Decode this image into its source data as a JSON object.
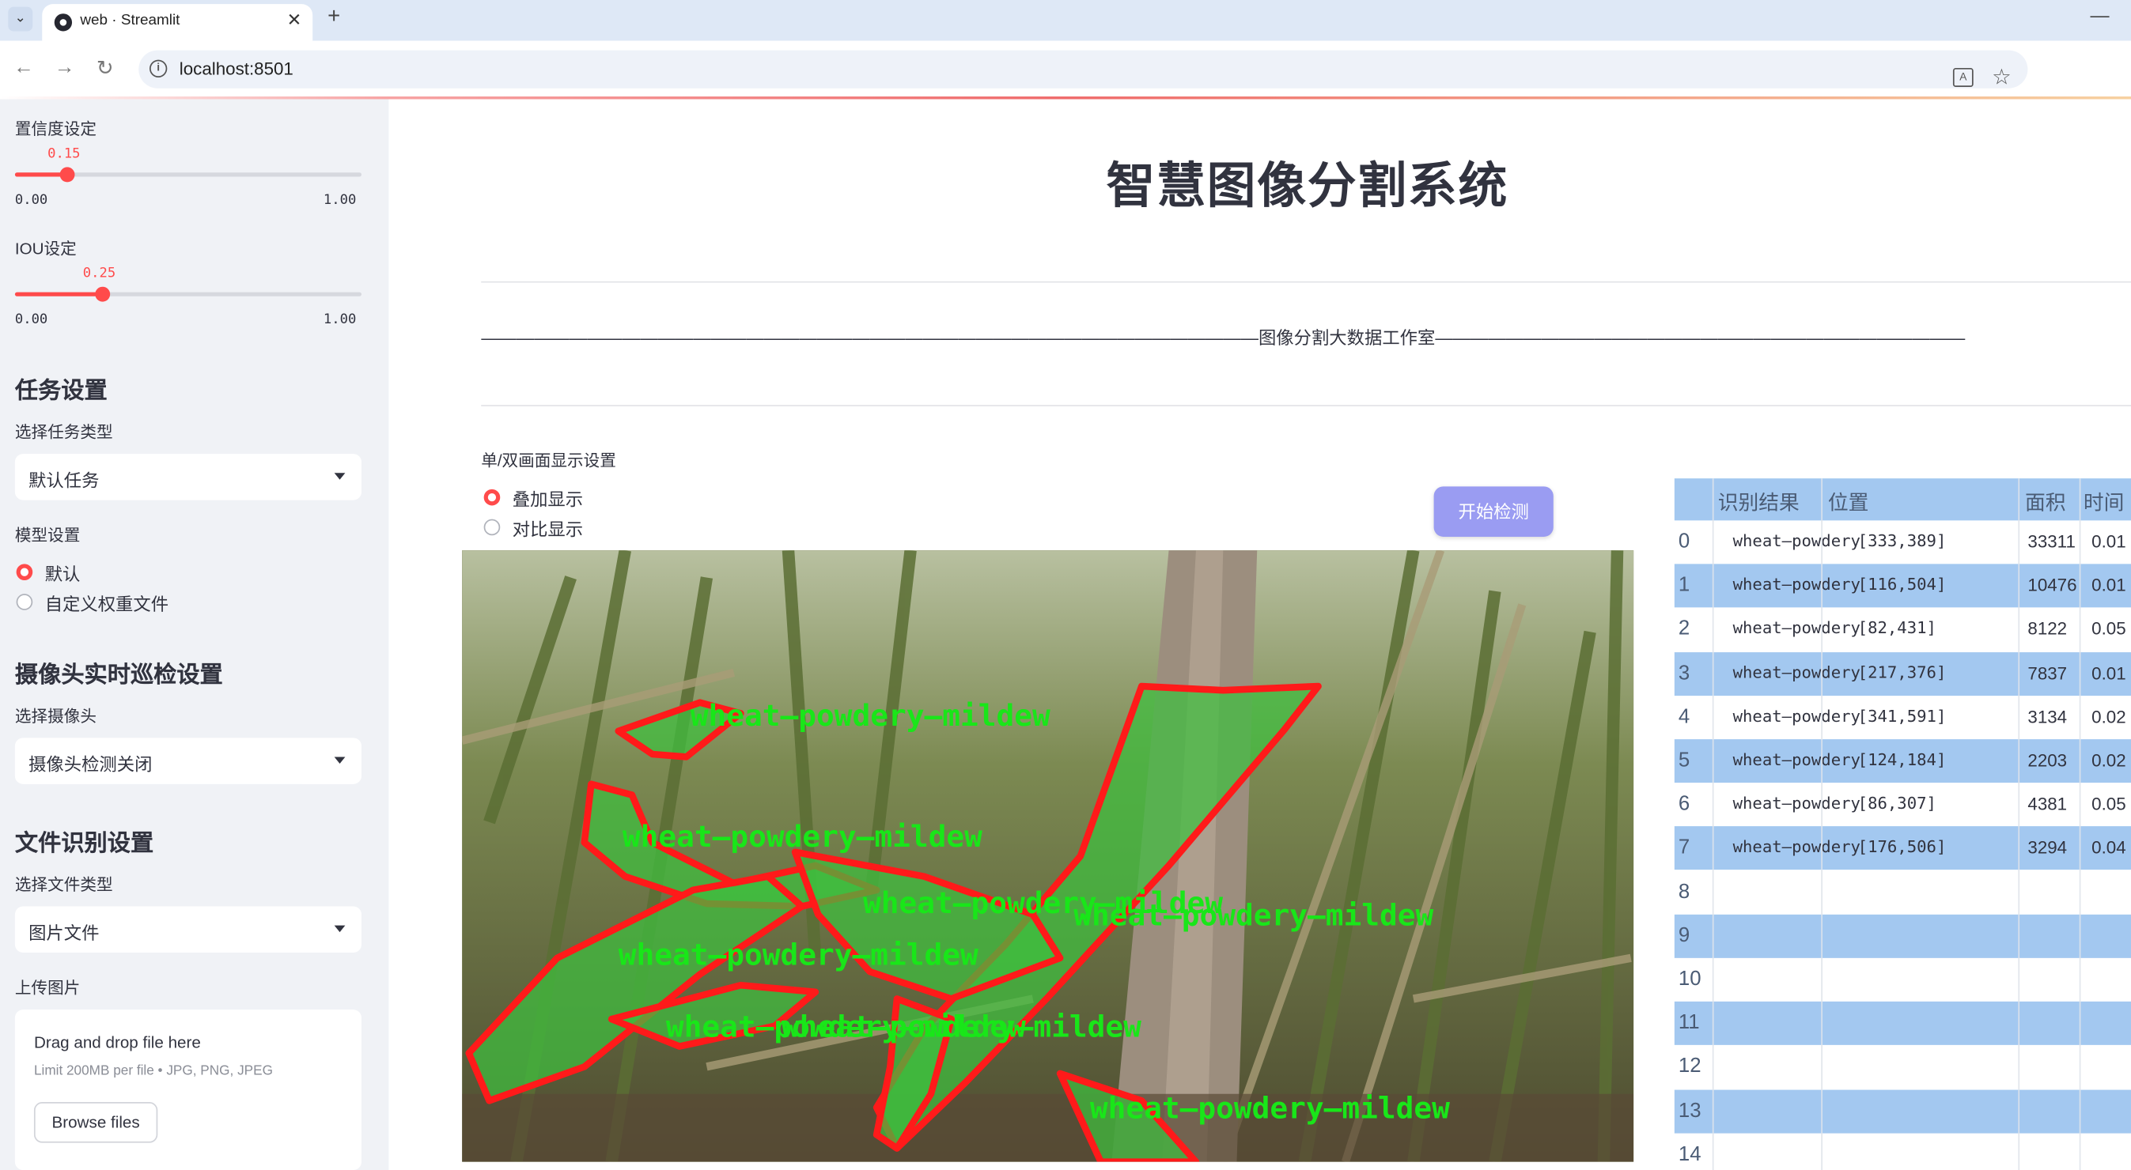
{
  "browser": {
    "tab_title": "web · Streamlit",
    "url": "localhost:8501"
  },
  "sidebar": {
    "confidence": {
      "label": "置信度设定",
      "value": "0.15",
      "value_fraction": 0.15,
      "min": "0.00",
      "max": "1.00"
    },
    "iou": {
      "label": "IOU设定",
      "value": "0.25",
      "value_fraction": 0.25,
      "min": "0.00",
      "max": "1.00"
    },
    "task_section": "任务设置",
    "task_type_label": "选择任务类型",
    "task_type_value": "默认任务",
    "model_label": "模型设置",
    "model_options": [
      {
        "label": "默认",
        "selected": true
      },
      {
        "label": "自定义权重文件",
        "selected": false
      }
    ],
    "camera_section": "摄像头实时巡检设置",
    "camera_label": "选择摄像头",
    "camera_value": "摄像头检测关闭",
    "file_section": "文件识别设置",
    "file_type_label": "选择文件类型",
    "file_type_value": "图片文件",
    "upload_label": "上传图片",
    "upload": {
      "title": "Drag and drop file here",
      "limit": "Limit 200MB per file • JPG, PNG, JPEG",
      "button": "Browse files"
    }
  },
  "main": {
    "title": "智慧图像分割系统",
    "studio_line": "————————————————————————————————————————————图像分割大数据工作室————————————————————————————————————————————",
    "display_label": "单/双画面显示设置",
    "display_options": [
      {
        "label": "叠加显示",
        "selected": true
      },
      {
        "label": "对比显示",
        "selected": false
      }
    ],
    "start_button": "开始检测",
    "detection_label": "wheat—powdery—mildew",
    "accent_color": "#ff4b4b",
    "mask_outline_color": "#ff1a1a",
    "mask_fill_color": "#3fbf3f",
    "label_color": "#19e619"
  },
  "results": {
    "headers": [
      "识别结果",
      "位置",
      "面积",
      "时间"
    ],
    "rows": [
      {
        "idx": "0",
        "cls": "wheat—powdery",
        "pos": "[333,389]",
        "area": "33311",
        "time": "0.01"
      },
      {
        "idx": "1",
        "cls": "wheat—powdery",
        "pos": "[116,504]",
        "area": "10476",
        "time": "0.01"
      },
      {
        "idx": "2",
        "cls": "wheat—powdery",
        "pos": "[82,431]",
        "area": "8122",
        "time": "0.05"
      },
      {
        "idx": "3",
        "cls": "wheat—powdery",
        "pos": "[217,376]",
        "area": "7837",
        "time": "0.01"
      },
      {
        "idx": "4",
        "cls": "wheat—powdery",
        "pos": "[341,591]",
        "area": "3134",
        "time": "0.02"
      },
      {
        "idx": "5",
        "cls": "wheat—powdery",
        "pos": "[124,184]",
        "area": "2203",
        "time": "0.02"
      },
      {
        "idx": "6",
        "cls": "wheat—powdery",
        "pos": "[86,307]",
        "area": "4381",
        "time": "0.05"
      },
      {
        "idx": "7",
        "cls": "wheat—powdery",
        "pos": "[176,506]",
        "area": "3294",
        "time": "0.04"
      },
      {
        "idx": "8",
        "cls": "",
        "pos": "",
        "area": "",
        "time": ""
      },
      {
        "idx": "9",
        "cls": "",
        "pos": "",
        "area": "",
        "time": ""
      },
      {
        "idx": "10",
        "cls": "",
        "pos": "",
        "area": "",
        "time": ""
      },
      {
        "idx": "11",
        "cls": "",
        "pos": "",
        "area": "",
        "time": ""
      },
      {
        "idx": "12",
        "cls": "",
        "pos": "",
        "area": "",
        "time": ""
      },
      {
        "idx": "13",
        "cls": "",
        "pos": "",
        "area": "",
        "time": ""
      },
      {
        "idx": "14",
        "cls": "",
        "pos": "",
        "area": "",
        "time": ""
      }
    ]
  }
}
